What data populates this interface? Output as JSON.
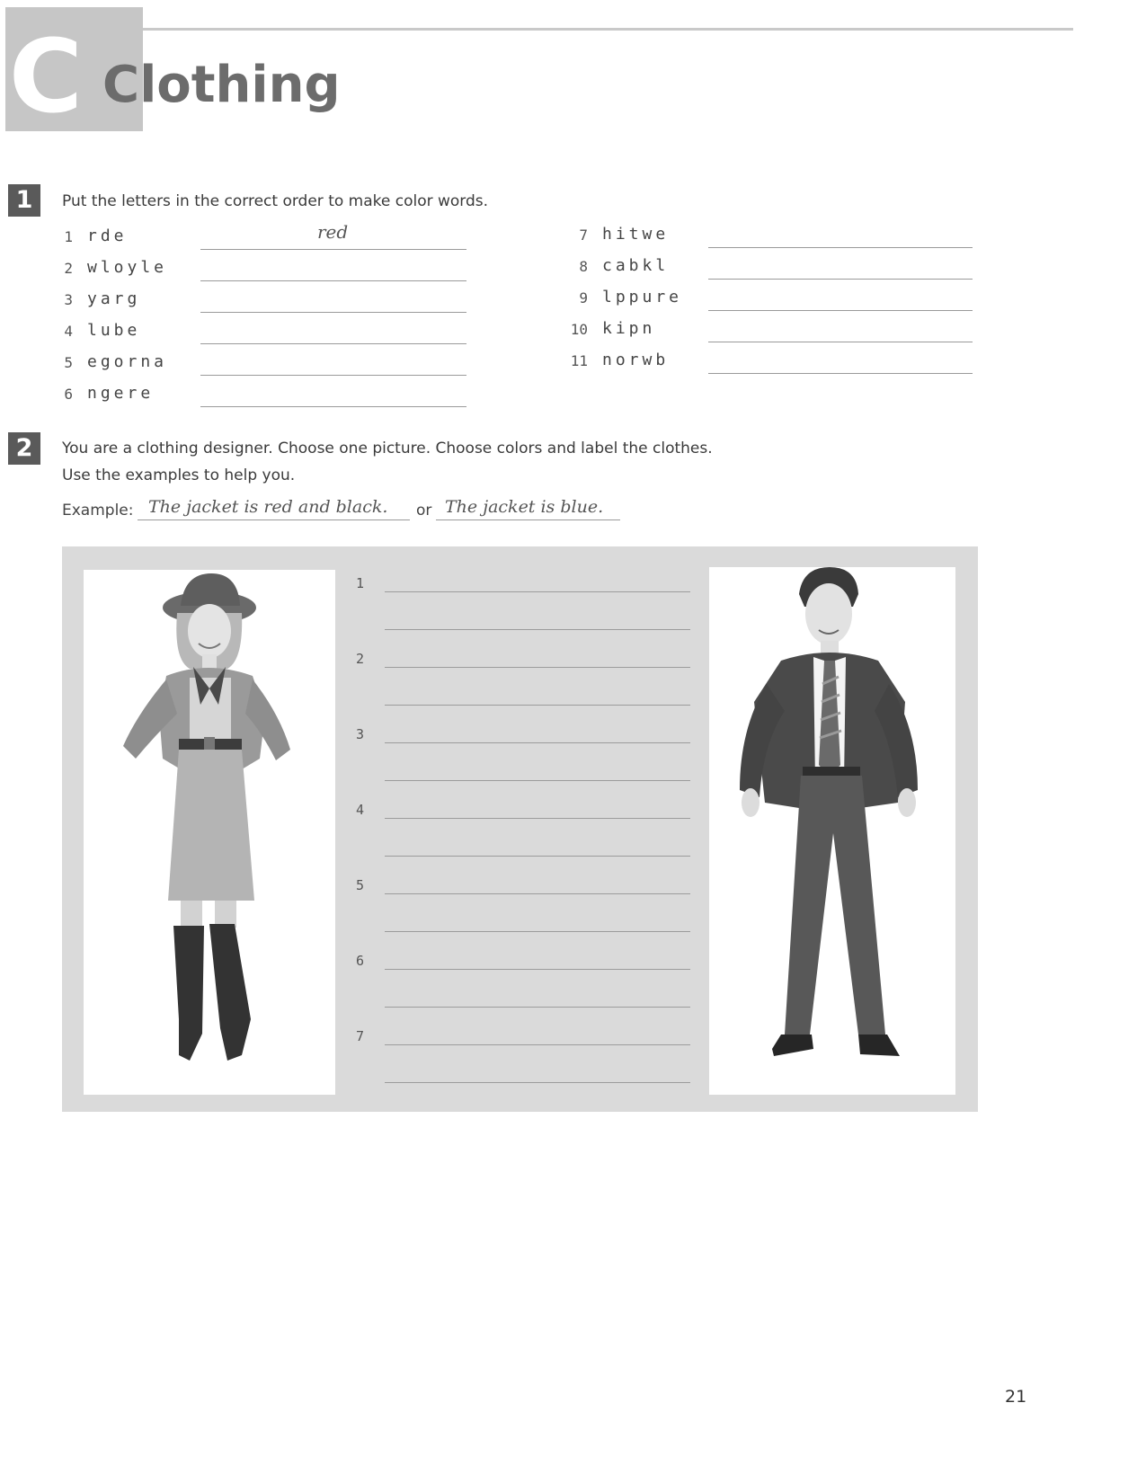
{
  "header": {
    "unit_letter": "C",
    "title": "Clothing"
  },
  "exercise1": {
    "badge": "1",
    "instruction": "Put the letters in the correct order to make color words.",
    "items_left": [
      {
        "num": "1",
        "scrambled": "rde",
        "answer": "red"
      },
      {
        "num": "2",
        "scrambled": "wloyle",
        "answer": ""
      },
      {
        "num": "3",
        "scrambled": "yarg",
        "answer": ""
      },
      {
        "num": "4",
        "scrambled": "lube",
        "answer": ""
      },
      {
        "num": "5",
        "scrambled": "egorna",
        "answer": ""
      },
      {
        "num": "6",
        "scrambled": "ngere",
        "answer": ""
      }
    ],
    "items_right": [
      {
        "num": "7",
        "scrambled": "hitwe",
        "answer": ""
      },
      {
        "num": "8",
        "scrambled": "cabkl",
        "answer": ""
      },
      {
        "num": "9",
        "scrambled": "lppure",
        "answer": ""
      },
      {
        "num": "10",
        "scrambled": "kipn",
        "answer": ""
      },
      {
        "num": "11",
        "scrambled": "norwb",
        "answer": ""
      }
    ]
  },
  "exercise2": {
    "badge": "2",
    "instruction_line1": "You are a clothing designer. Choose one picture. Choose colors and label the clothes.",
    "instruction_line2": "Use the examples to help you.",
    "example_label": "Example:",
    "example_answer1": "The jacket is red and black.",
    "example_or": "or",
    "example_answer2": "The jacket is blue.",
    "label_numbers": [
      "1",
      "2",
      "3",
      "4",
      "5",
      "6",
      "7"
    ]
  },
  "page_number": "21",
  "colors": {
    "badge": "#5a5a5a",
    "header_block": "#c6c6c6",
    "panel": "#dadada"
  },
  "icons": [
    "woman-figure-illustration",
    "man-figure-illustration"
  ]
}
